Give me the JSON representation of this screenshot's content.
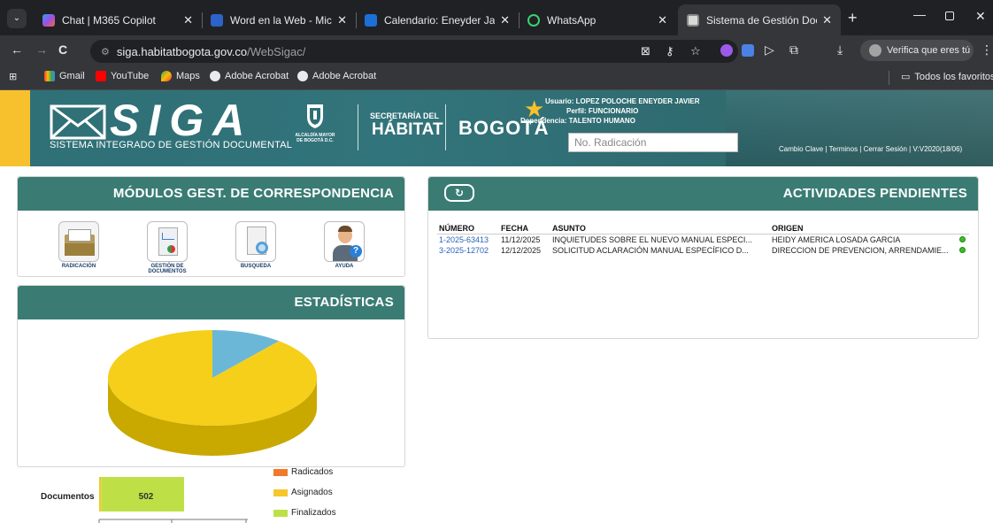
{
  "colors": {
    "accent": "#3a7c73",
    "header": "#2f6f76",
    "yellow": "#f6c12c",
    "radicados": "#f07a2a",
    "asignados": "#f5c72a",
    "finalizados": "#bee046",
    "pie_main": "#f5cf1a",
    "pie_slice": "#6bb7d8"
  },
  "tabs": [
    {
      "label": "Chat | M365 Copilot",
      "icon": "copilot-icon"
    },
    {
      "label": "Word en la Web - Microsoft",
      "icon": "word-icon"
    },
    {
      "label": "Calendario: Eneyder Javier L",
      "icon": "calendar-icon"
    },
    {
      "label": "WhatsApp",
      "icon": "whatsapp-icon"
    },
    {
      "label": "Sistema de Gestión Docume",
      "icon": "siga-icon",
      "active": true
    }
  ],
  "browser": {
    "url_host": "siga.habitatbogota.gov.co",
    "url_path": "/WebSigac/",
    "verify_label": "Verifica que eres tú"
  },
  "bookmarks": [
    "Gmail",
    "YouTube",
    "Maps",
    "Adobe Acrobat",
    "Adobe Acrobat"
  ],
  "all_bookmarks": "Todos los favoritos",
  "header": {
    "logo_text": "SIGA",
    "logo_subtitle": "SISTEMA INTEGRADO DE GESTIÓN DOCUMENTAL",
    "alcaldia": "ALCALDÍA MAYOR DE BOGOTÁ D.C.",
    "secretaria": "SECRETARÍA DEL",
    "habitat": "HÁBITAT",
    "bogota": "BOGOTÁ",
    "usuario": "Usuario: LOPEZ POLOCHE ENEYDER JAVIER",
    "perfil": "Perfil: FUNCIONARIO",
    "dependencia": "Dependencia: TALENTO HUMANO",
    "radicacion_placeholder": "No. Radicación",
    "links": "Cambio Clave | Terminos | Cerrar Sesión | V:V2020(18/06)"
  },
  "modules": {
    "title": "MÓDULOS GEST. DE CORRESPONDENCIA",
    "items": [
      {
        "label": "RADICACIÓN",
        "icon": "inbox-tray-icon"
      },
      {
        "label": "GESTIÓN DE DOCUMENTOS",
        "icon": "document-chart-icon"
      },
      {
        "label": "BUSQUEDA",
        "icon": "search-document-icon"
      },
      {
        "label": "AYUDA",
        "icon": "help-person-icon"
      }
    ]
  },
  "stats": {
    "title": "ESTADÍSTICAS"
  },
  "activities": {
    "title": "ACTIVIDADES PENDIENTES",
    "columns": [
      "NÚMERO",
      "FECHA",
      "ASUNTO",
      "ORIGEN"
    ],
    "rows": [
      [
        "1-2025-63413",
        "11/12/2025",
        "INQUIETUDES SOBRE EL NUEVO MANUAL ESPECI...",
        "HEIDY AMERICA LOSADA GARCIA"
      ],
      [
        "3-2025-12702",
        "12/12/2025",
        "SOLICITUD ACLARACIÓN MANUAL ESPECÍFICO D...",
        "DIRECCION DE PREVENCION, ARRENDAMIE..."
      ]
    ]
  },
  "chart_data": [
    {
      "type": "pie",
      "title": "",
      "slices": [
        {
          "label": "",
          "value": 89
        },
        {
          "label": "",
          "value": 11
        }
      ]
    },
    {
      "type": "bar",
      "orientation": "horizontal",
      "categories": [
        "Documentos"
      ],
      "series": [
        {
          "name": "Radicados",
          "values": [
            0
          ]
        },
        {
          "name": "Asignados",
          "values": [
            12
          ]
        },
        {
          "name": "Finalizados",
          "values": [
            502
          ]
        }
      ],
      "data_labels": [
        "502"
      ]
    }
  ]
}
